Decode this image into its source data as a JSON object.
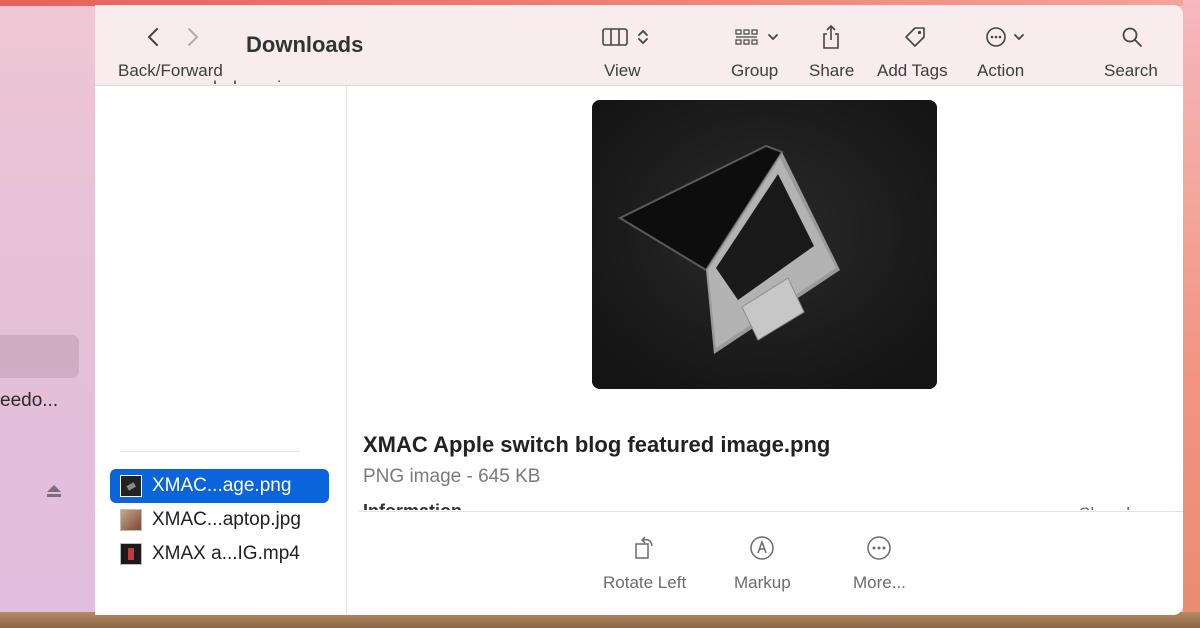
{
  "toolbar": {
    "back_forward_label": "Back/Forward",
    "title": "Downloads",
    "view_label": "View",
    "group_label": "Group",
    "share_label": "Share",
    "add_tags_label": "Add Tags",
    "action_label": "Action",
    "search_label": "Search"
  },
  "sidebar": {
    "partial_label": "eedo..."
  },
  "file_list": {
    "top_cut_name": "rooneroledo ruzip",
    "items": [
      {
        "name": "XMAC...age.png",
        "selected": true
      },
      {
        "name": "XMAC...aptop.jpg",
        "selected": false
      },
      {
        "name": "XMAX a...IG.mp4",
        "selected": false
      }
    ]
  },
  "preview": {
    "file_name": "XMAC Apple switch blog featured image.png",
    "meta": "PNG image - 645 KB",
    "info_heading": "Information",
    "info_right": "Show less"
  },
  "quick_actions": {
    "rotate_left": "Rotate Left",
    "markup": "Markup",
    "more": "More..."
  },
  "colors": {
    "selection": "#0b64da",
    "toolbar_bg": "#f8ecef"
  }
}
